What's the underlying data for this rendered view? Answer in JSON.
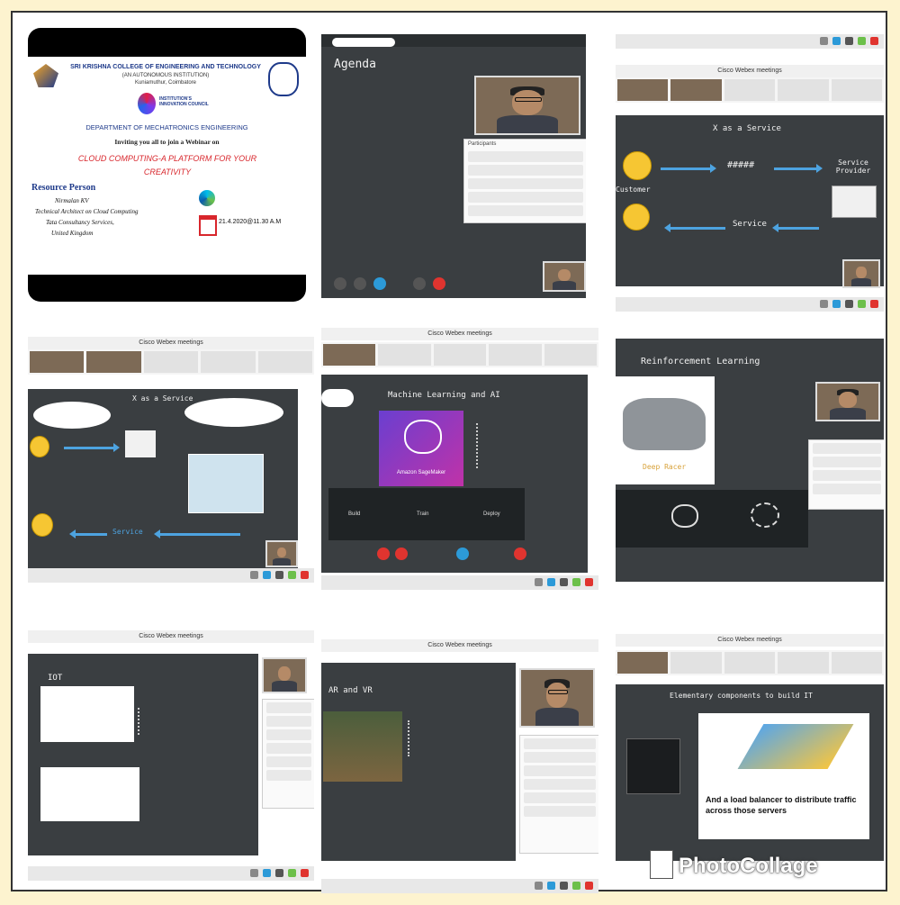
{
  "poster": {
    "college": "SRI KRISHNA COLLEGE OF ENGINEERING AND TECHNOLOGY",
    "autonomous": "(AN AUTONOMOUS INSTITUTION)",
    "location": "Kuniamuthur, Coimbatore",
    "iic": "INSTITUTION'S INNOVATION COUNCIL",
    "department": "DEPARTMENT OF MECHATRONICS ENGINEERING",
    "invite": "Inviting you all to join a Webinar on",
    "topic": "CLOUD COMPUTING-A PLATFORM FOR YOUR CREATIVITY",
    "resource_heading": "Resource Person",
    "speaker_name": "Nirmalan KV",
    "speaker_role": "Technical Architect on Cloud Computing",
    "speaker_company": "Tata Consultancy Services,",
    "speaker_country": "United Kingdom",
    "datetime": "21.4.2020@11.30 A.M"
  },
  "slides": {
    "agenda": "Agenda",
    "xaas": "X as a Service",
    "service_provider": "Service Provider",
    "customer": "Customer",
    "service": "Service",
    "hashes": "#####",
    "ml_ai": "Machine Learning and AI",
    "sagemaker": "Amazon SageMaker",
    "build": "Build",
    "train": "Train",
    "deploy": "Deploy",
    "reinforcement": "Reinforcement Learning",
    "deepracer": "Deep Racer",
    "iot": "IOT",
    "arvr": "AR and VR",
    "elementary": "Elementary components to build IT",
    "load_balancer": "And a load balancer to distribute traffic across those servers",
    "meeting_title": "Cisco Webex meetings",
    "participants": "Participants"
  },
  "watermark": "PhotoCollage",
  "colors": {
    "chalkboard": "#3a3e41",
    "accent_blue": "#4da3e0",
    "topic_red": "#d8262c",
    "sagemaker_purple": "#6a3fd0"
  }
}
